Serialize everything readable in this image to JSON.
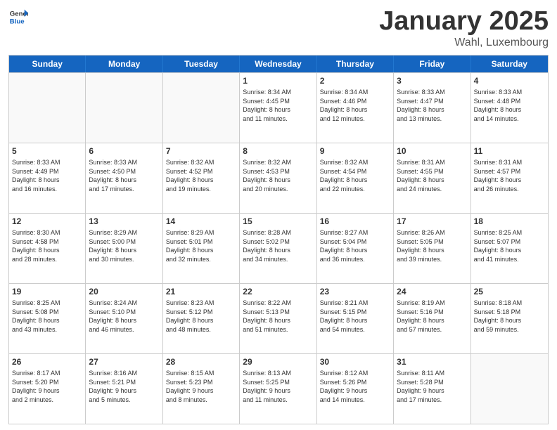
{
  "header": {
    "logo": {
      "general": "General",
      "blue": "Blue"
    },
    "title": "January 2025",
    "subtitle": "Wahl, Luxembourg"
  },
  "days_of_week": [
    "Sunday",
    "Monday",
    "Tuesday",
    "Wednesday",
    "Thursday",
    "Friday",
    "Saturday"
  ],
  "weeks": [
    [
      {
        "day": "",
        "empty": true
      },
      {
        "day": "",
        "empty": true
      },
      {
        "day": "",
        "empty": true
      },
      {
        "day": "1",
        "line1": "Sunrise: 8:34 AM",
        "line2": "Sunset: 4:45 PM",
        "line3": "Daylight: 8 hours",
        "line4": "and 11 minutes."
      },
      {
        "day": "2",
        "line1": "Sunrise: 8:34 AM",
        "line2": "Sunset: 4:46 PM",
        "line3": "Daylight: 8 hours",
        "line4": "and 12 minutes."
      },
      {
        "day": "3",
        "line1": "Sunrise: 8:33 AM",
        "line2": "Sunset: 4:47 PM",
        "line3": "Daylight: 8 hours",
        "line4": "and 13 minutes."
      },
      {
        "day": "4",
        "line1": "Sunrise: 8:33 AM",
        "line2": "Sunset: 4:48 PM",
        "line3": "Daylight: 8 hours",
        "line4": "and 14 minutes."
      }
    ],
    [
      {
        "day": "5",
        "line1": "Sunrise: 8:33 AM",
        "line2": "Sunset: 4:49 PM",
        "line3": "Daylight: 8 hours",
        "line4": "and 16 minutes."
      },
      {
        "day": "6",
        "line1": "Sunrise: 8:33 AM",
        "line2": "Sunset: 4:50 PM",
        "line3": "Daylight: 8 hours",
        "line4": "and 17 minutes."
      },
      {
        "day": "7",
        "line1": "Sunrise: 8:32 AM",
        "line2": "Sunset: 4:52 PM",
        "line3": "Daylight: 8 hours",
        "line4": "and 19 minutes."
      },
      {
        "day": "8",
        "line1": "Sunrise: 8:32 AM",
        "line2": "Sunset: 4:53 PM",
        "line3": "Daylight: 8 hours",
        "line4": "and 20 minutes."
      },
      {
        "day": "9",
        "line1": "Sunrise: 8:32 AM",
        "line2": "Sunset: 4:54 PM",
        "line3": "Daylight: 8 hours",
        "line4": "and 22 minutes."
      },
      {
        "day": "10",
        "line1": "Sunrise: 8:31 AM",
        "line2": "Sunset: 4:55 PM",
        "line3": "Daylight: 8 hours",
        "line4": "and 24 minutes."
      },
      {
        "day": "11",
        "line1": "Sunrise: 8:31 AM",
        "line2": "Sunset: 4:57 PM",
        "line3": "Daylight: 8 hours",
        "line4": "and 26 minutes."
      }
    ],
    [
      {
        "day": "12",
        "line1": "Sunrise: 8:30 AM",
        "line2": "Sunset: 4:58 PM",
        "line3": "Daylight: 8 hours",
        "line4": "and 28 minutes."
      },
      {
        "day": "13",
        "line1": "Sunrise: 8:29 AM",
        "line2": "Sunset: 5:00 PM",
        "line3": "Daylight: 8 hours",
        "line4": "and 30 minutes."
      },
      {
        "day": "14",
        "line1": "Sunrise: 8:29 AM",
        "line2": "Sunset: 5:01 PM",
        "line3": "Daylight: 8 hours",
        "line4": "and 32 minutes."
      },
      {
        "day": "15",
        "line1": "Sunrise: 8:28 AM",
        "line2": "Sunset: 5:02 PM",
        "line3": "Daylight: 8 hours",
        "line4": "and 34 minutes."
      },
      {
        "day": "16",
        "line1": "Sunrise: 8:27 AM",
        "line2": "Sunset: 5:04 PM",
        "line3": "Daylight: 8 hours",
        "line4": "and 36 minutes."
      },
      {
        "day": "17",
        "line1": "Sunrise: 8:26 AM",
        "line2": "Sunset: 5:05 PM",
        "line3": "Daylight: 8 hours",
        "line4": "and 39 minutes."
      },
      {
        "day": "18",
        "line1": "Sunrise: 8:25 AM",
        "line2": "Sunset: 5:07 PM",
        "line3": "Daylight: 8 hours",
        "line4": "and 41 minutes."
      }
    ],
    [
      {
        "day": "19",
        "line1": "Sunrise: 8:25 AM",
        "line2": "Sunset: 5:08 PM",
        "line3": "Daylight: 8 hours",
        "line4": "and 43 minutes."
      },
      {
        "day": "20",
        "line1": "Sunrise: 8:24 AM",
        "line2": "Sunset: 5:10 PM",
        "line3": "Daylight: 8 hours",
        "line4": "and 46 minutes."
      },
      {
        "day": "21",
        "line1": "Sunrise: 8:23 AM",
        "line2": "Sunset: 5:12 PM",
        "line3": "Daylight: 8 hours",
        "line4": "and 48 minutes."
      },
      {
        "day": "22",
        "line1": "Sunrise: 8:22 AM",
        "line2": "Sunset: 5:13 PM",
        "line3": "Daylight: 8 hours",
        "line4": "and 51 minutes."
      },
      {
        "day": "23",
        "line1": "Sunrise: 8:21 AM",
        "line2": "Sunset: 5:15 PM",
        "line3": "Daylight: 8 hours",
        "line4": "and 54 minutes."
      },
      {
        "day": "24",
        "line1": "Sunrise: 8:19 AM",
        "line2": "Sunset: 5:16 PM",
        "line3": "Daylight: 8 hours",
        "line4": "and 57 minutes."
      },
      {
        "day": "25",
        "line1": "Sunrise: 8:18 AM",
        "line2": "Sunset: 5:18 PM",
        "line3": "Daylight: 8 hours",
        "line4": "and 59 minutes."
      }
    ],
    [
      {
        "day": "26",
        "line1": "Sunrise: 8:17 AM",
        "line2": "Sunset: 5:20 PM",
        "line3": "Daylight: 9 hours",
        "line4": "and 2 minutes."
      },
      {
        "day": "27",
        "line1": "Sunrise: 8:16 AM",
        "line2": "Sunset: 5:21 PM",
        "line3": "Daylight: 9 hours",
        "line4": "and 5 minutes."
      },
      {
        "day": "28",
        "line1": "Sunrise: 8:15 AM",
        "line2": "Sunset: 5:23 PM",
        "line3": "Daylight: 9 hours",
        "line4": "and 8 minutes."
      },
      {
        "day": "29",
        "line1": "Sunrise: 8:13 AM",
        "line2": "Sunset: 5:25 PM",
        "line3": "Daylight: 9 hours",
        "line4": "and 11 minutes."
      },
      {
        "day": "30",
        "line1": "Sunrise: 8:12 AM",
        "line2": "Sunset: 5:26 PM",
        "line3": "Daylight: 9 hours",
        "line4": "and 14 minutes."
      },
      {
        "day": "31",
        "line1": "Sunrise: 8:11 AM",
        "line2": "Sunset: 5:28 PM",
        "line3": "Daylight: 9 hours",
        "line4": "and 17 minutes."
      },
      {
        "day": "",
        "empty": true
      }
    ]
  ]
}
